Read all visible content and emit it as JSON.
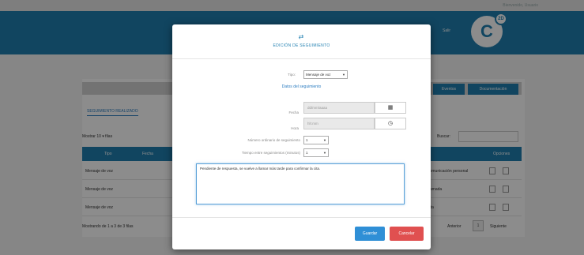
{
  "app": {
    "user_text": "Bienvenido, Usuario",
    "header_text": "Salir",
    "logo_text": "C",
    "logo_sup": "2D",
    "nav_buttons": [
      "Eventos",
      "Documentación"
    ],
    "section_title": "SEGUIMIENTO REALIZADO",
    "show_text": "Mostrar 10 ▾ filas",
    "search_label": "Buscar:",
    "table": {
      "headers": [
        "Tipo",
        "Fecha",
        "Opciones"
      ],
      "rows": [
        {
          "tipo": "Mensaje de voz",
          "extra": "Comunicación personal"
        },
        {
          "tipo": "Mensaje de voz",
          "extra": "Llamada"
        },
        {
          "tipo": "Mensaje de voz",
          "extra": "Cita"
        }
      ]
    },
    "info_text": "Mostrando de 1 a 3 de 3 filas",
    "pager_prev": "Anterior",
    "pager_page": "1",
    "pager_next": "Siguiente"
  },
  "modal": {
    "icon": "arrows-icon",
    "title": "EDICIÓN DE SEGUIMIENTO",
    "tipo_label": "Tipo:",
    "tipo_value": "Mensaje de voz",
    "sublink": "Datos del seguimiento",
    "fecha_label": "Fecha",
    "fecha_value": "dd/mm/aaaa",
    "hora_label": "Hora",
    "hora_value": "hh:mm",
    "num_label": "Número ordinario de seguimiento",
    "num_value": "1",
    "tiempo_label": "Tiempo entre seguimientos (minutos)",
    "tiempo_value": "1",
    "textarea_value": "Pendiente de respuesta, se vuelve a llamar más tarde para confirmar la cita.",
    "save_label": "Guardar",
    "cancel_label": "Cancelar"
  }
}
